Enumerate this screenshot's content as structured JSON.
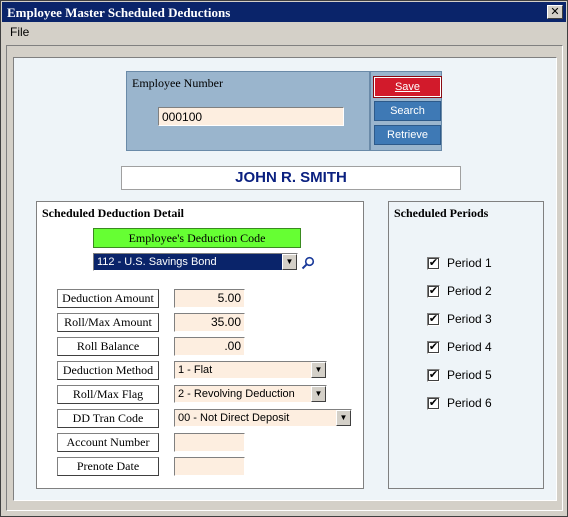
{
  "window": {
    "title": "Employee Master Scheduled Deductions",
    "close_glyph": "✕"
  },
  "menu": {
    "file": "File"
  },
  "employee": {
    "number_label": "Employee Number",
    "number_value": "000100",
    "name": "JOHN R. SMITH"
  },
  "buttons": {
    "save": "Save",
    "search": "Search",
    "retrieve": "Retrieve"
  },
  "detail": {
    "group_title": "Scheduled Deduction Detail",
    "code_button": "Employee's Deduction Code",
    "code_selected": "112 - U.S. Savings Bond",
    "fields": {
      "deduction_amount_label": "Deduction Amount",
      "deduction_amount_value": "5.00",
      "roll_max_amount_label": "Roll/Max Amount",
      "roll_max_amount_value": "35.00",
      "roll_balance_label": "Roll Balance",
      "roll_balance_value": ".00",
      "deduction_method_label": "Deduction Method",
      "deduction_method_value": "1 - Flat",
      "roll_max_flag_label": "Roll/Max Flag",
      "roll_max_flag_value": "2 - Revolving Deduction",
      "dd_tran_code_label": "DD Tran Code",
      "dd_tran_code_value": "00 - Not Direct Deposit",
      "account_number_label": "Account Number",
      "account_number_value": "",
      "prenote_date_label": "Prenote Date",
      "prenote_date_value": ""
    }
  },
  "periods": {
    "group_title": "Scheduled Periods",
    "check_glyph": "✔",
    "items": [
      {
        "label": "Period 1",
        "checked": true
      },
      {
        "label": "Period 2",
        "checked": true
      },
      {
        "label": "Period 3",
        "checked": true
      },
      {
        "label": "Period 4",
        "checked": true
      },
      {
        "label": "Period 5",
        "checked": true
      },
      {
        "label": "Period 6",
        "checked": true
      }
    ]
  },
  "icons": {
    "dropdown_arrow": "▼",
    "magnifier": "magnifier-icon"
  },
  "colors": {
    "title_bar": "#0a246a",
    "save_button": "#d21a2b",
    "action_button": "#3e79b5",
    "code_button": "#66ff33",
    "input_fill": "#fdeee0",
    "name_text": "#0a2080"
  }
}
